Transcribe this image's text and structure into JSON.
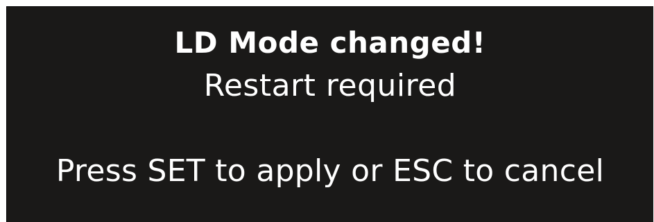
{
  "dialog": {
    "title": "LD Mode changed!",
    "subtitle": "Restart required",
    "prompt": "Press SET to apply or ESC to cancel"
  },
  "colors": {
    "screen_background": "#1a1918",
    "text": "#ffffff",
    "page_background": "#ffffff"
  }
}
